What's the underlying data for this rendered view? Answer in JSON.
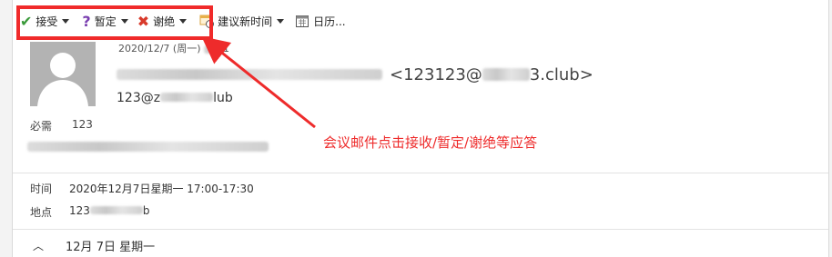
{
  "toolbar": {
    "accept_label": "接受",
    "tentative_label": "暂定",
    "decline_label": "谢绝",
    "propose_time_label": "建议新时间",
    "calendar_label": "日历..."
  },
  "message": {
    "sent_time_visible": "2020/12/7 (周一) ",
    "sent_time_tail": "31",
    "sender_email_prefix": "<123123@",
    "sender_email_suffix": "3.club>",
    "recipient_prefix": "123@z",
    "recipient_suffix": "lub"
  },
  "required": {
    "label": "必需",
    "value": "123"
  },
  "meeting": {
    "time_label": "时间",
    "time_value": "2020年12月7日星期一 17:00-17:30",
    "location_label": "地点",
    "location_value": "123",
    "location_tail": "b"
  },
  "calendar_day": {
    "label": "12月 7日  星期一"
  },
  "annotation": {
    "text": "会议邮件点击接收/暂定/谢绝等应答"
  },
  "colors": {
    "highlight": "#f02a2a",
    "annotation": "#ee2b2b",
    "accept": "#3a9a3a",
    "tentative": "#7a3fb0",
    "decline": "#d83a2b"
  }
}
